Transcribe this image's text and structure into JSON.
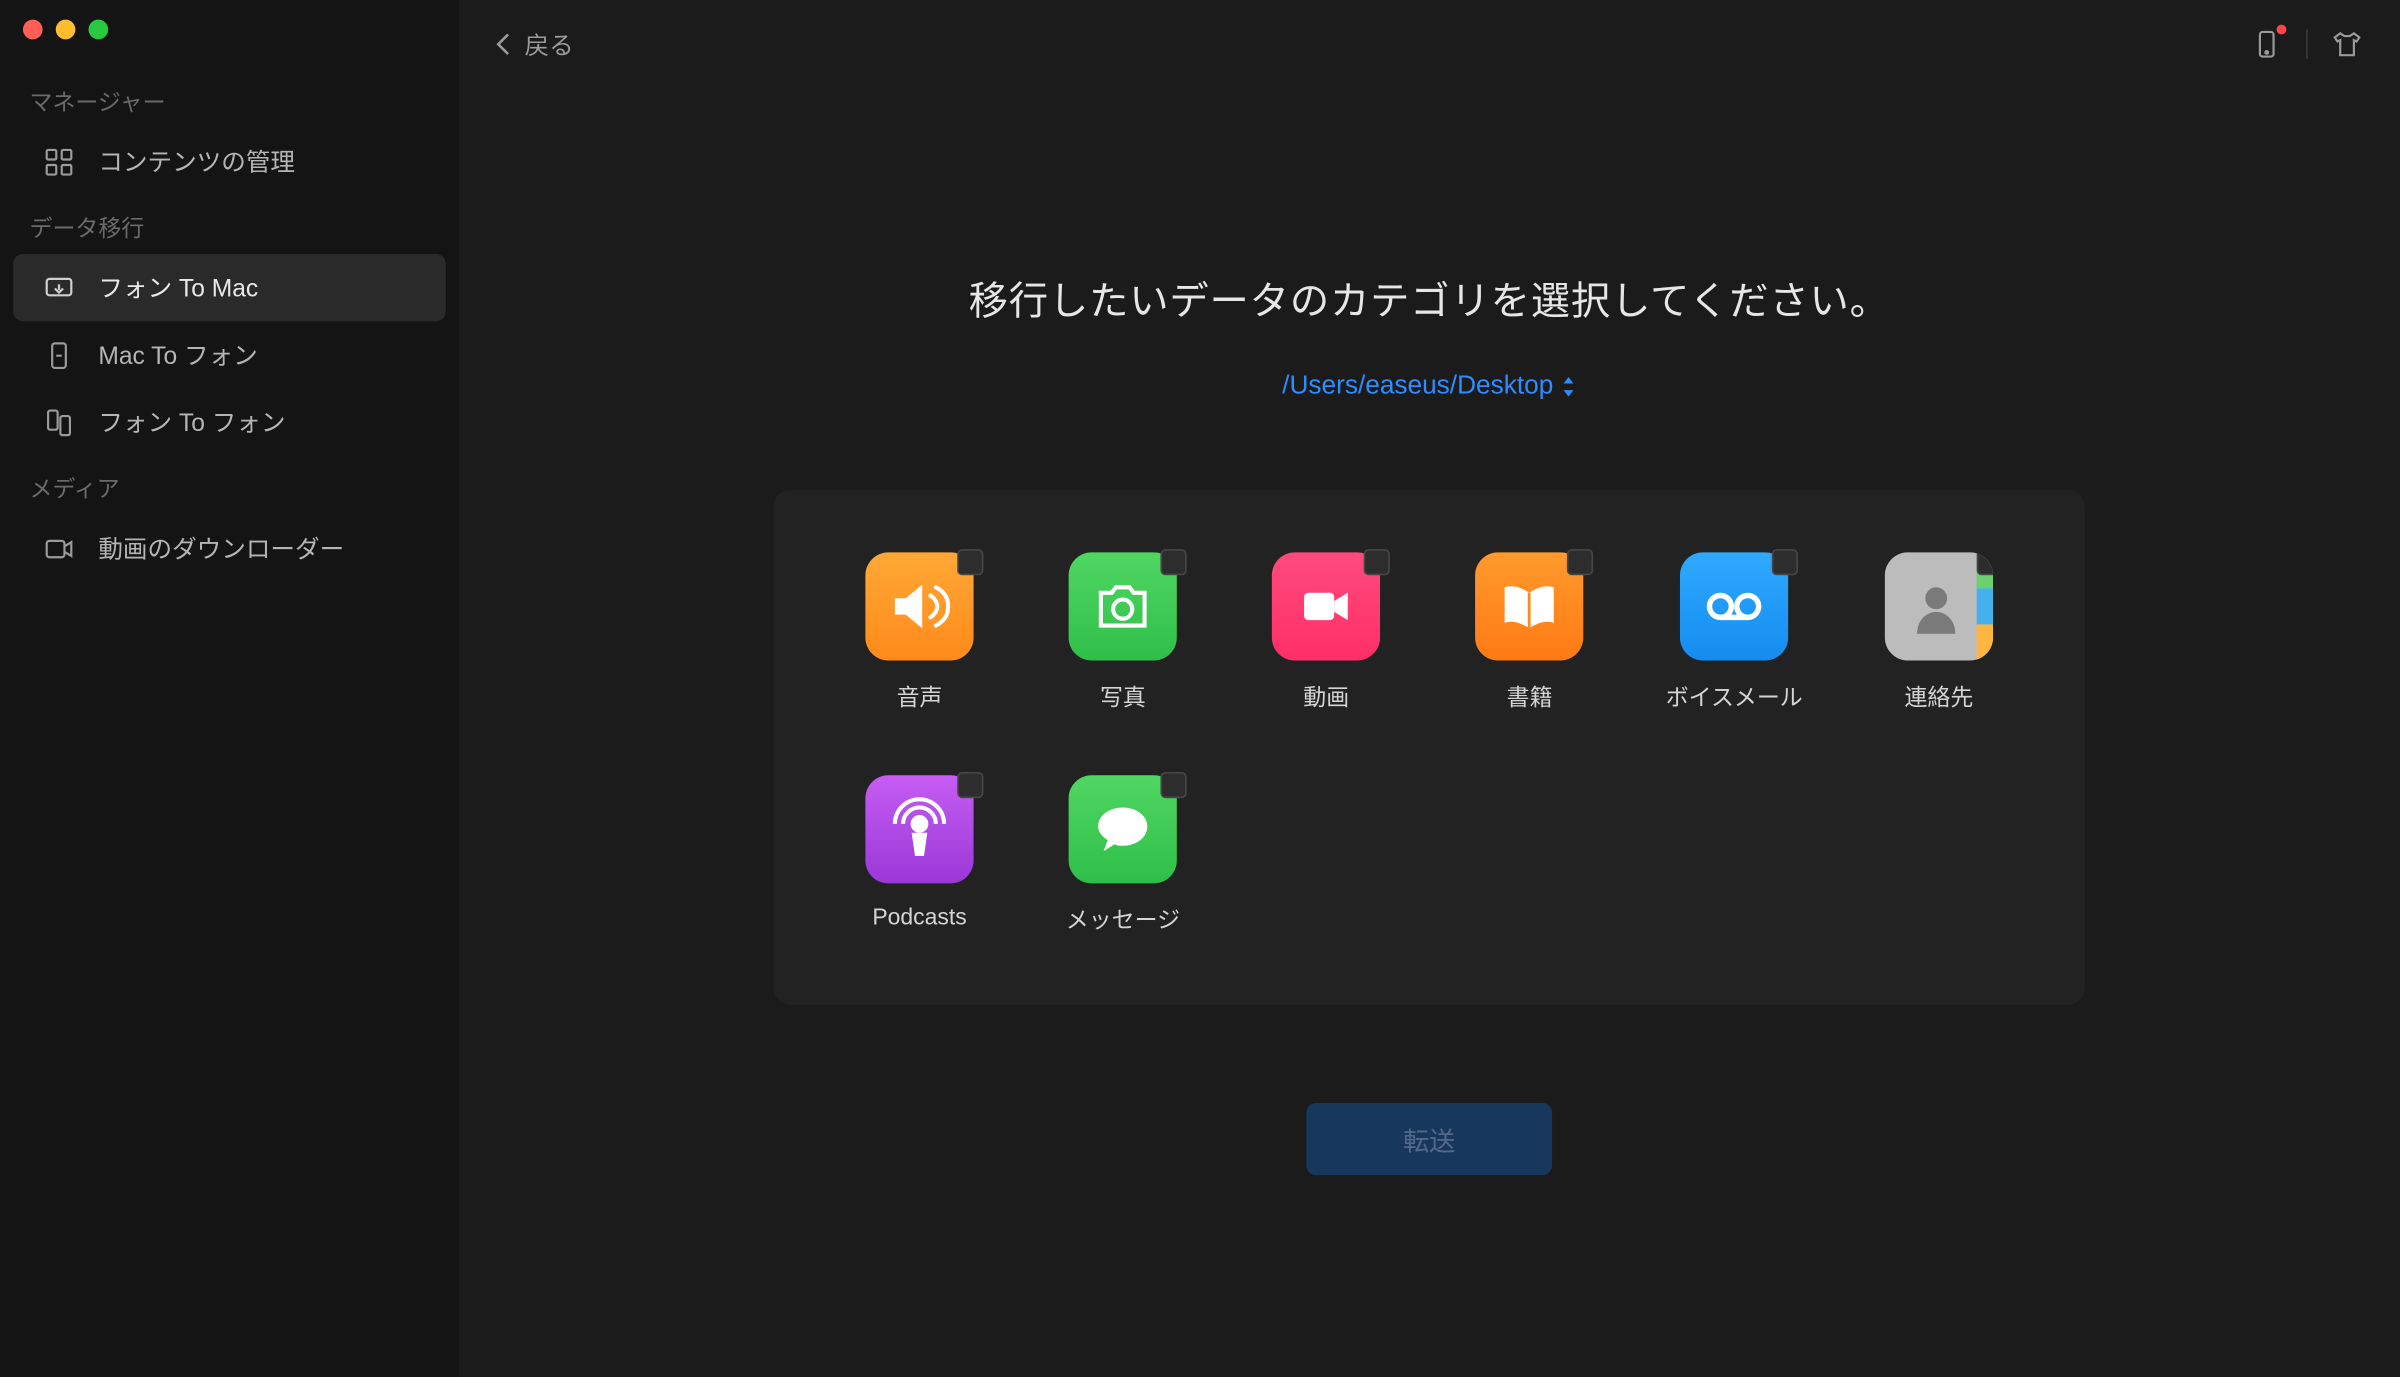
{
  "header": {
    "back_label": "戻る"
  },
  "sidebar": {
    "sections": [
      {
        "label": "マネージャー"
      },
      {
        "label": "データ移行"
      },
      {
        "label": "メディア"
      }
    ],
    "items": {
      "content_mgmt": "コンテンツの管理",
      "phone_to_mac": "フォン To Mac",
      "mac_to_phone": "Mac To フォン",
      "phone_to_phone": "フォン To フォン",
      "video_downloader": "動画のダウンローダー"
    }
  },
  "main": {
    "title": "移行したいデータのカテゴリを選択してください。",
    "path": "/Users/easeus/Desktop",
    "categories": [
      {
        "key": "audio",
        "label": "音声"
      },
      {
        "key": "photo",
        "label": "写真"
      },
      {
        "key": "video",
        "label": "動画"
      },
      {
        "key": "books",
        "label": "書籍"
      },
      {
        "key": "voicemail",
        "label": "ボイスメール"
      },
      {
        "key": "contacts",
        "label": "連絡先"
      },
      {
        "key": "podcasts",
        "label": "Podcasts"
      },
      {
        "key": "messages",
        "label": "メッセージ"
      }
    ],
    "transfer_button": "転送"
  }
}
